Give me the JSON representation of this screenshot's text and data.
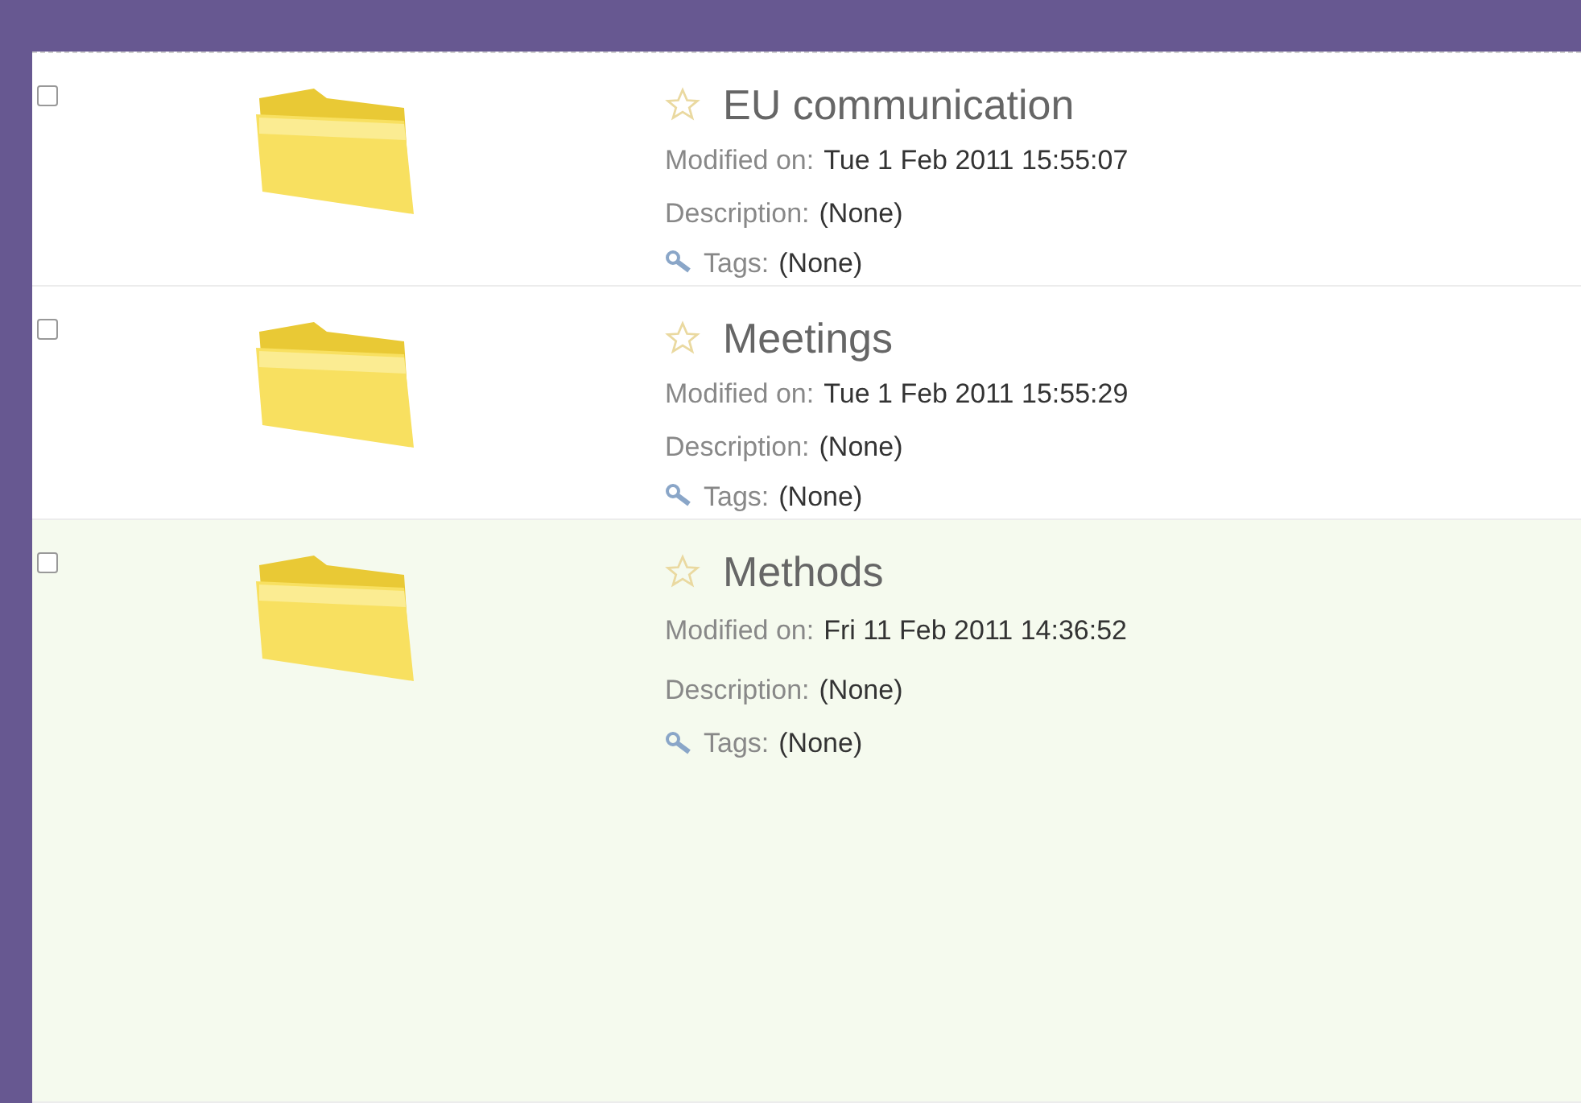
{
  "items": [
    {
      "name": "EU communication",
      "favorite": false,
      "checked": false,
      "selected": false,
      "modified_label": "Modified on:",
      "modified": "Tue 1 Feb 2011 15:55:07",
      "description_label": "Description:",
      "description": "(None)",
      "tags_label": "Tags:",
      "tags": "(None)"
    },
    {
      "name": "Meetings",
      "favorite": false,
      "checked": false,
      "selected": false,
      "modified_label": "Modified on:",
      "modified": "Tue 1 Feb 2011 15:55:29",
      "description_label": "Description:",
      "description": "(None)",
      "tags_label": "Tags:",
      "tags": "(None)"
    },
    {
      "name": "Methods",
      "favorite": false,
      "checked": false,
      "selected": true,
      "modified_label": "Modified on:",
      "modified": "Fri 11 Feb 2011 14:36:52",
      "description_label": "Description:",
      "description": "(None)",
      "tags_label": "Tags:",
      "tags": "(None)"
    }
  ]
}
